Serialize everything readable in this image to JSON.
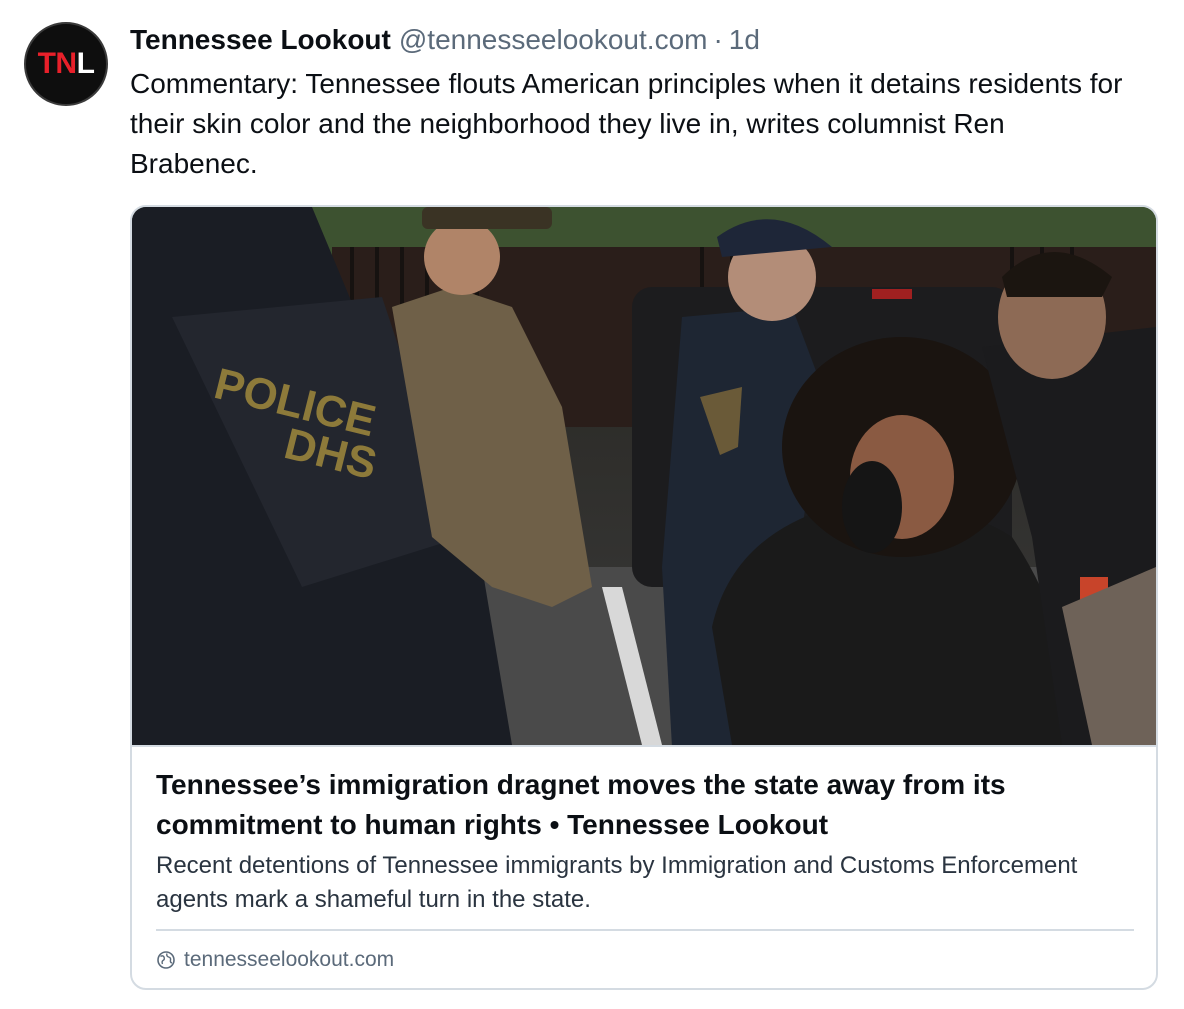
{
  "post": {
    "avatar": {
      "text_part1": "T",
      "text_part2": "N",
      "text_part3": "L",
      "icon": "tennessee-lookout-logo"
    },
    "author": {
      "display_name": "Tennessee Lookout",
      "handle": "@tennesseelookout.com",
      "separator": "·",
      "timestamp": "1d"
    },
    "text": "Commentary: Tennessee flouts American principles when it detains residents for their skin color and the neighborhood they live in, writes columnist Ren Brabenec."
  },
  "link_card": {
    "image_icon": "news-photo",
    "title": "Tennessee’s immigration dragnet moves the state away from its commitment to human rights • Tennessee Lookout",
    "description": "Recent detentions of Tennessee immigrants by Immigration and Customs Enforcement agents mark a shameful turn in the state.",
    "domain_icon": "globe-icon",
    "domain": "tennesseelookout.com"
  },
  "colors": {
    "brand_red": "#e8202a",
    "text_primary": "#0b0f14",
    "text_secondary": "#5b6a7a",
    "border": "#d4dbe2"
  }
}
